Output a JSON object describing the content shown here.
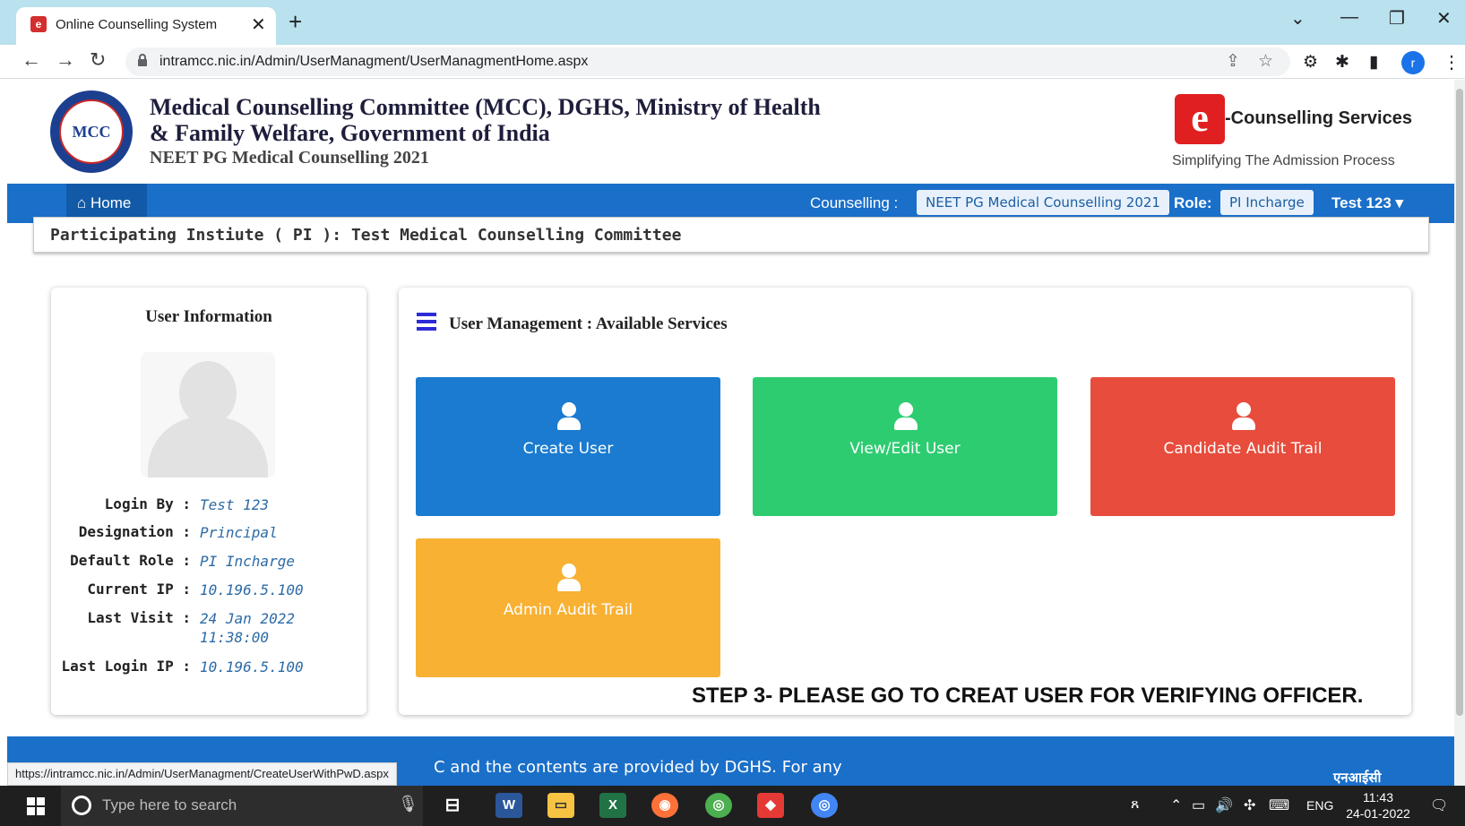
{
  "browser": {
    "tab_title": "Online Counselling System",
    "tab_close": "✕",
    "new_tab": "+",
    "url": "intramcc.nic.in/Admin/UserManagment/UserManagmentHome.aspx",
    "profile_initial": "r",
    "status_url": "https://intramcc.nic.in/Admin/UserManagment/CreateUserWithPwD.aspx"
  },
  "header": {
    "logo_text": "MCC",
    "title_line1": "Medical Counselling Committee (MCC), DGHS, Ministry of Health",
    "title_line2": "& Family Welfare, Government of India",
    "subtitle": "NEET PG Medical Counselling 2021",
    "ec_logo_letter": "e",
    "ec_title": "-Counselling Services",
    "ec_tagline": "Simplifying The Admission Process"
  },
  "navbar": {
    "home": "Home",
    "counselling_label": "Counselling :",
    "counselling_value": "NEET PG Medical Counselling 2021",
    "role_label": "Role:",
    "role_value": "PI Incharge",
    "user": "Test 123 ▾"
  },
  "pi_bar": {
    "text": "Participating Instiute ( PI ): Test Medical Counselling Committee"
  },
  "user_info": {
    "title": "User Information",
    "rows": [
      {
        "label": "Login By :",
        "value": "Test 123"
      },
      {
        "label": "Designation :",
        "value": "Principal"
      },
      {
        "label": "Default Role :",
        "value": "PI Incharge"
      },
      {
        "label": "Current IP :",
        "value": "10.196.5.100"
      },
      {
        "label": "Last Visit :",
        "value": "24 Jan 2022 11:38:00"
      },
      {
        "label": "Last Login IP :",
        "value": "10.196.5.100"
      }
    ]
  },
  "services": {
    "title": "User Management : Available Services",
    "tiles": [
      {
        "label": "Create User",
        "color": "#1a7bd0"
      },
      {
        "label": "View/Edit User",
        "color": "#2ecc71"
      },
      {
        "label": "Candidate Audit Trail",
        "color": "#e74c3c"
      },
      {
        "label": "Admin Audit Trail",
        "color": "#f8b133"
      }
    ]
  },
  "annotation": {
    "step_note": "STEP 3- PLEASE GO TO CREAT USER FOR VERIFYING OFFICER."
  },
  "footer": {
    "text": "C and the contents are provided by DGHS. For any",
    "nic": "एनआईसी"
  },
  "taskbar": {
    "search_placeholder": "Type here to search",
    "language": "ENG",
    "time": "11:43",
    "date": "24-01-2022"
  },
  "colors": {
    "navbar": "#1a6fc9",
    "tabstrip": "#b9e1ee"
  }
}
